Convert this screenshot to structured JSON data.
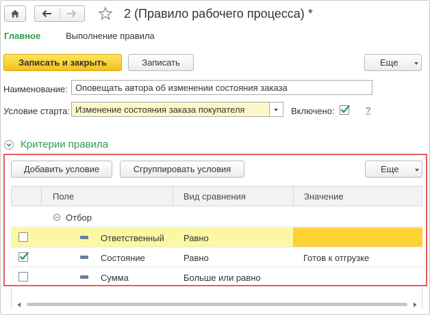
{
  "window": {
    "title": "2 (Правило рабочего процесса) *"
  },
  "tabs": {
    "main": "Главное",
    "execution": "Выполнение правила"
  },
  "toolbar": {
    "save_close": "Записать и закрыть",
    "save": "Записать",
    "more": "Еще"
  },
  "form": {
    "name_label": "Наименование:",
    "name_value": "Оповещать автора об изменении состояния заказа",
    "start_label": "Условие старта:",
    "start_value": "Изменение состояния заказа покупателя",
    "enabled_label": "Включено:",
    "enabled": true,
    "help": "?"
  },
  "criteria": {
    "title": "Критерии правила",
    "add_condition": "Добавить условие",
    "group_conditions": "Сгруппировать условия",
    "more": "Еще",
    "columns": [
      "Поле",
      "Вид сравнения",
      "Значение"
    ],
    "group_row": "Отбор",
    "rows": [
      {
        "checked": false,
        "field": "Ответственный",
        "comparison": "Равно",
        "value": ""
      },
      {
        "checked": true,
        "field": "Состояние",
        "comparison": "Равно",
        "value": "Готов к отгрузке"
      },
      {
        "checked": false,
        "field": "Сумма",
        "comparison": "Больше или равно",
        "value": ""
      }
    ]
  },
  "colors": {
    "accent_green": "#2e9c4f",
    "primary_yellow": "#f3c01b",
    "highlight_row": "#fbf7a4",
    "highlight_cell": "#fcd235",
    "frame_red": "#e35d5d"
  }
}
